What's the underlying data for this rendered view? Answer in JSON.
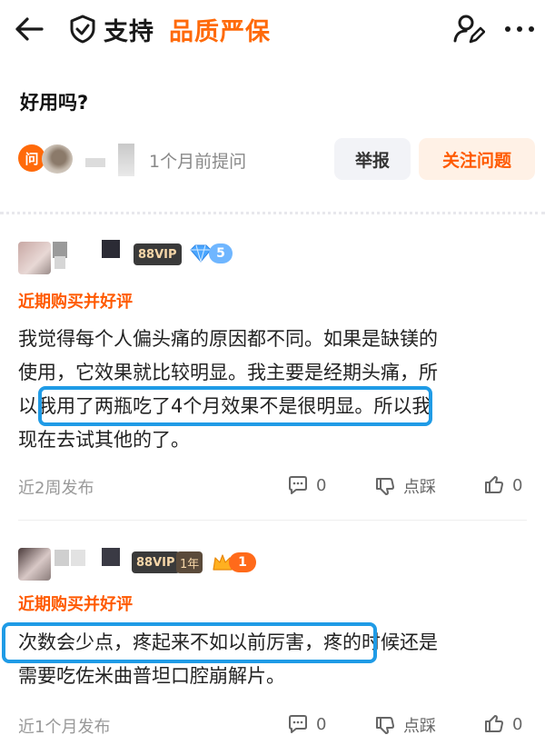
{
  "header": {
    "brand": "支持",
    "tag": "品质严保",
    "icons": [
      "back-arrow-icon",
      "shield-check-icon",
      "user-edit-icon",
      "more-icon"
    ],
    "colors": {
      "accent": "#ff6a0a",
      "highlight": "#1f9be6"
    }
  },
  "question": {
    "title": "好用吗?",
    "asker_badge": "问",
    "time": "1个月前提问",
    "report_label": "举报",
    "follow_label": "关注问题"
  },
  "answers": [
    {
      "vip_label": "88VIP",
      "gem_level": "5",
      "tag": "近期购买并好评",
      "content_lines": [
        "我觉得每个人偏头痛的原因都不同。如果是缺镁的",
        "使用，它效果就比较明显。我主要是经期头痛，所",
        "以我用了两瓶吃了4个月效果不是很明显。所以我",
        "现在去试其他的了。"
      ],
      "time": "近2周发布",
      "comment_count": "0",
      "dislike_label": "点踩",
      "like_count": "0"
    },
    {
      "vip_label": "88VIP",
      "year_label": "1年",
      "crown_level": "1",
      "tag": "近期购买并好评",
      "content_lines": [
        "次数会少点，疼起来不如以前厉害，疼的时候还是",
        "需要吃佐米曲普坦口腔崩解片。"
      ],
      "time": "近1个月发布",
      "comment_count": "0",
      "dislike_label": "点踩",
      "like_count": "0"
    }
  ]
}
